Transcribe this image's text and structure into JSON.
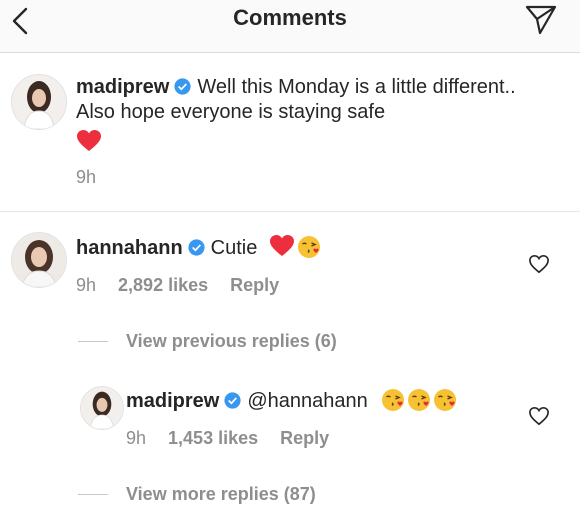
{
  "header": {
    "title": "Comments"
  },
  "caption": {
    "username": "madiprew",
    "text": "Well this Monday is a little different.. Also hope everyone is staying safe",
    "time": "9h"
  },
  "comment": {
    "username": "hannahann",
    "text": "Cutie",
    "time": "9h",
    "likes": "2,892 likes",
    "reply_label": "Reply"
  },
  "view_previous": "View previous replies (6)",
  "reply": {
    "username": "madiprew",
    "text": "@hannahann",
    "time": "9h",
    "likes": "1,453 likes",
    "reply_label": "Reply"
  },
  "view_more": "View more replies (87)",
  "colors": {
    "verified": "#3897f0",
    "heart": "#ed4956",
    "muted": "#8e8e8e"
  }
}
